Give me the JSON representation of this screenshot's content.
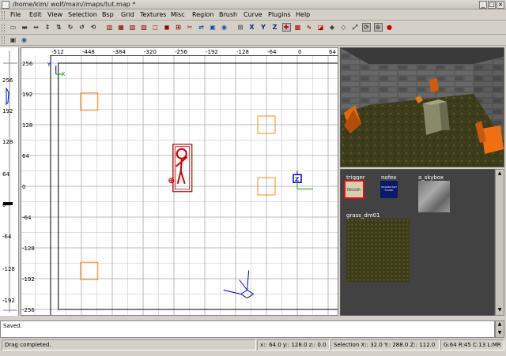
{
  "window": {
    "title": "/home/kim/ wolf/main//maps/tut.map *",
    "buttons": [
      "_",
      "□",
      "×"
    ]
  },
  "menubar": [
    "File",
    "Edit",
    "View",
    "Selection",
    "Bsp",
    "Grid",
    "Textures",
    "Misc",
    "Region",
    "Brush",
    "Curve",
    "Plugins",
    "Help"
  ],
  "toolbar": {
    "icons": [
      "open-icon",
      "save-icon",
      "flip-x-icon",
      "flip-y-icon",
      "flip-z-icon",
      "rotate-x-icon",
      "rotate-y-icon",
      "rotate-z-icon",
      "select-complete-tall-icon",
      "select-touching-icon",
      "select-partial-tall-icon",
      "select-inside-icon",
      "csg-hollow-icon",
      "csg-subtract-icon",
      "csg-merge-icon",
      "clipper-icon",
      "change-view-icon",
      "cubic-clip-icon",
      "camera-icon",
      "texture-lock-icon",
      "view-x-icon",
      "view-y-icon",
      "view-z-icon",
      "entity-icon",
      "patch-icon",
      "curve-icon",
      "texture-icon",
      "drag-edges-icon",
      "drag-vertices-icon",
      "scale-icon",
      "rotate-icon",
      "show-entities-icon",
      "marker-icon"
    ],
    "icons2": [
      "cube-icon",
      "plugin-icon"
    ]
  },
  "xyview": {
    "x_ticks": [
      "-512",
      "-448",
      "-384",
      "-320",
      "-256",
      "-192",
      "-128",
      "-64",
      "0",
      "64"
    ],
    "y_ticks": [
      "256",
      "192",
      "128",
      "64",
      "0",
      "-64",
      "-128",
      "-192",
      "-256"
    ],
    "axis_label_x": "X",
    "axis_label_y": "Y",
    "entity_marker": "Z",
    "colors": {
      "grid": "#c0c0c0",
      "major": "#000000",
      "entity": "#ff8c1a",
      "selection": "#cc0000",
      "camera": "#0000cc"
    }
  },
  "zruler": {
    "ticks": [
      "256",
      "192",
      "128",
      "64",
      "0",
      "-64",
      "-128",
      "-192"
    ]
  },
  "textures": [
    {
      "name": "trigger",
      "selected": true,
      "caption": "TRIGGER"
    },
    {
      "name": "nofex",
      "selected": false,
      "caption": "SHADER NOT FOUND"
    },
    {
      "name": "a_skybox",
      "selected": false,
      "caption": ""
    },
    {
      "name": "grass_dm01",
      "selected": false,
      "caption": ""
    }
  ],
  "console": {
    "text": "Saved."
  },
  "status": {
    "message": "Drag completed.",
    "coords": "x:: 64.0   y:: 128.0   z:: 0.0",
    "selection": "Selection X:: 32.0  Y:: 288.0  Z:: 112.0",
    "grid": "G:64 R:45 C:13 L:MR"
  }
}
